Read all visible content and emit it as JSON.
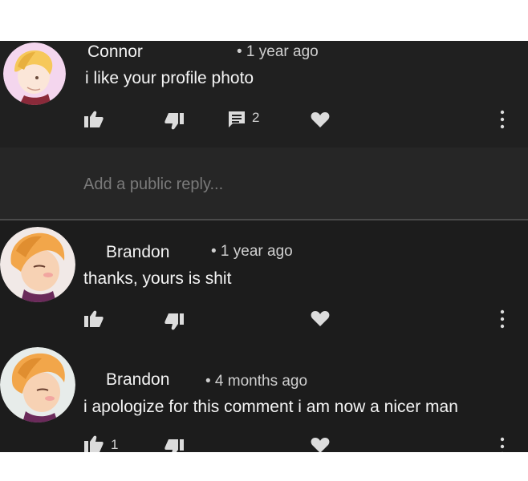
{
  "comments": [
    {
      "author": "Connor",
      "time": "• 1 year ago",
      "text": "i like your profile photo",
      "reply_count": "2"
    },
    {
      "author": "Brandon",
      "time": "• 1 year ago",
      "text": "thanks, yours is shit"
    },
    {
      "author": "Brandon",
      "time": "• 4 months ago",
      "text": "i apologize for this comment i am now a nicer man",
      "like_count": "1"
    }
  ],
  "reply": {
    "placeholder": "Add a public reply..."
  },
  "colors": {
    "background": "#1c1c1c",
    "band": "#202020",
    "reply_area": "#262626",
    "text": "#f4f4f4",
    "muted": "#7a7a7a",
    "icon": "#dcdcdc"
  }
}
